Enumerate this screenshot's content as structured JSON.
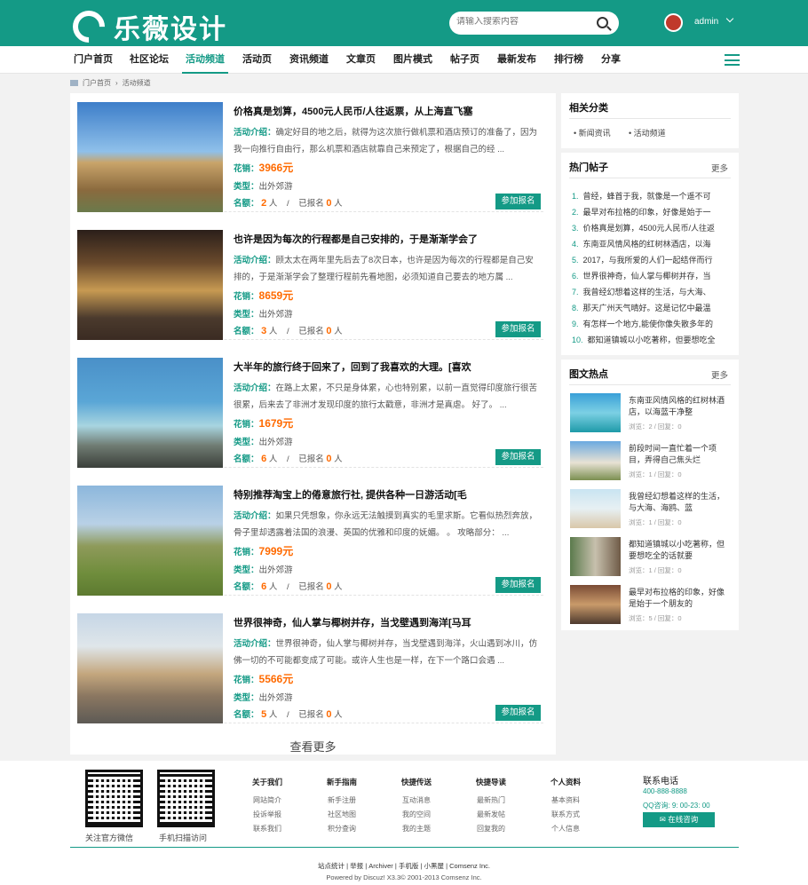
{
  "header": {
    "logo": "乐薇设计",
    "search_placeholder": "请输入搜索内容",
    "username": "admin"
  },
  "nav": [
    "门户首页",
    "社区论坛",
    "活动频道",
    "活动页",
    "资讯频道",
    "文章页",
    "图片模式",
    "帖子页",
    "最新发布",
    "排行榜",
    "分享"
  ],
  "breadcrumb": [
    "门户首页",
    "活动频道"
  ],
  "labels": {
    "intro": "活动介绍：",
    "price": "花销：",
    "type": "类型：",
    "signup": "名额：",
    "person": "人",
    "slash": "/",
    "already": "已报名",
    "join": "参加报名",
    "more": "查看更多"
  },
  "activities": [
    {
      "title": "价格真是划算，4500元人民币/人往返票，从上海直飞塞",
      "desc": "确定好目的地之后，就得为这次旅行做机票和酒店预订的准备了，因为我一向推行自由行，那么机票和酒店就靠自己来预定了，根据自己的经 ...",
      "price": "3966元",
      "type": "出外郊游",
      "quota": "2",
      "signed": "0"
    },
    {
      "title": "也许是因为每次的行程都是自己安排的，于是渐渐学会了",
      "desc": "顾太太在两年里先后去了8次日本，也许是因为每次的行程都是自己安排的，于是渐渐学会了整理行程前先看地图，必须知道自己要去的地方属 ...",
      "price": "8659元",
      "type": "出外郊游",
      "quota": "3",
      "signed": "0"
    },
    {
      "title": "大半年的旅行终于回来了，回到了我喜欢的大理。[喜欢",
      "desc": "在路上太累，不只是身体累，心也特别累，以前一直觉得印度旅行很苦很累，后来去了非洲才发现印度的旅行太戳意，非洲才是真虐。 好了。 ...",
      "price": "1679元",
      "type": "出外郊游",
      "quota": "6",
      "signed": "0"
    },
    {
      "title": "特别推荐淘宝上的倦意旅行社, 提供各种一日游活动[毛",
      "desc": "如果只凭想象，你永远无法触摸到真实的毛里求斯。它看似热烈奔放，骨子里却透露着法国的浪漫、英国的优雅和印度的妩媚。 。 攻略部分： ...",
      "price": "7999元",
      "type": "出外郊游",
      "quota": "6",
      "signed": "0"
    },
    {
      "title": "世界很神奇，仙人掌与椰树并存，当戈壁遇到海洋[马耳",
      "desc": "世界很神奇，仙人掌与椰树并存，当戈壁遇到海洋，火山遇到冰川，仿佛一切的不可能都变成了可能。或许人生也是一样，在下一个路口会遇 ...",
      "price": "5566元",
      "type": "出外郊游",
      "quota": "5",
      "signed": "0"
    }
  ],
  "sidebar": {
    "categories_title": "相关分类",
    "categories": [
      "新闻资讯",
      "活动频道"
    ],
    "hot_title": "热门帖子",
    "more": "更多",
    "hot_posts": [
      "曾经，蜂首于我，就像是一个遥不可",
      "最早对布拉格的印象，好像是始于一",
      "价格真是划算，4500元人民币/人往返",
      "东南亚风情风格的红树林酒店，以海",
      "2017，与我所爱的人们一起结伴而行",
      "世界很神奇，仙人掌与椰树并存，当",
      "我曾经幻想着这样的生活，与大海、",
      "那天广州天气晴好。这是记忆中最温",
      "有怎样一个地方,能使你像失散多年的",
      "都知道镇城以小吃著称，但要想吃全"
    ],
    "pic_title": "图文热点",
    "pic_posts": [
      {
        "title": "东南亚风情风格的红树林酒店，以海蓝干净整",
        "stats": "浏览：2 / 回复：0"
      },
      {
        "title": "前段时间一直忙着一个项目，弄得自己焦头烂",
        "stats": "浏览：1 / 回复：0"
      },
      {
        "title": "我曾经幻想着这样的生活，与大海、海鸥、蓝",
        "stats": "浏览：1 / 回复：0"
      },
      {
        "title": "都知道镇城以小吃著称，但要想吃全的话就要",
        "stats": "浏览：1 / 回复：0"
      },
      {
        "title": "最早对布拉格的印象，好像是始于一个朋友的",
        "stats": "浏览：5 / 回复：0"
      }
    ]
  },
  "footer": {
    "qr_labels": [
      "关注官方微信",
      "手机扫描访问"
    ],
    "cols": [
      {
        "h": "关于我们",
        "items": [
          "网站简介",
          "投诉举报",
          "联系我们"
        ]
      },
      {
        "h": "新手指南",
        "items": [
          "新手注册",
          "社区地图",
          "积分查询"
        ]
      },
      {
        "h": "快捷传送",
        "items": [
          "互动消息",
          "我的空间",
          "我的主题"
        ]
      },
      {
        "h": "快捷导读",
        "items": [
          "最新热门",
          "最新发帖",
          "回复我的"
        ]
      },
      {
        "h": "个人资料",
        "items": [
          "基本资料",
          "联系方式",
          "个人信息"
        ]
      }
    ],
    "tel_label": "联系电话",
    "tel": "400-888-8888",
    "qq": "QQ咨询: 9: 00-23: 00",
    "consult": "在线咨询",
    "links": "站点统计 | 举报 | Archiver | 手机版 | 小黑屋 | Comsenz Inc.",
    "powered": "Powered by Discuz! X3.3© 2001-2013 Comsenz Inc."
  }
}
